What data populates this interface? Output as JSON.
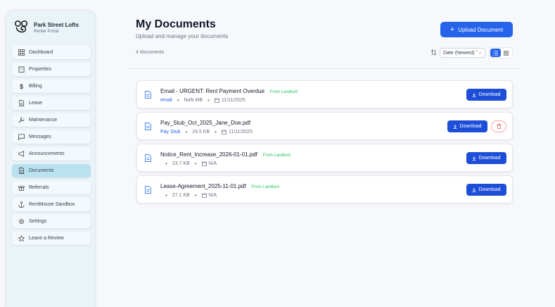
{
  "brand": {
    "name": "Park Street Lofts",
    "subtitle": "Renter Portal"
  },
  "sidebar": {
    "items": [
      {
        "label": "Dashboard",
        "icon": "dashboard-icon",
        "active": false
      },
      {
        "label": "Properties",
        "icon": "building-icon",
        "active": false
      },
      {
        "label": "Billing",
        "icon": "dollar-icon",
        "active": false
      },
      {
        "label": "Lease",
        "icon": "file-icon",
        "active": false
      },
      {
        "label": "Maintenance",
        "icon": "wrench-icon",
        "active": false
      },
      {
        "label": "Messages",
        "icon": "message-icon",
        "active": false
      },
      {
        "label": "Announcements",
        "icon": "megaphone-icon",
        "active": false
      },
      {
        "label": "Documents",
        "icon": "document-icon",
        "active": true
      },
      {
        "label": "Referrals",
        "icon": "gift-icon",
        "active": false
      },
      {
        "label": "RentMouse Sandbox",
        "icon": "anchor-icon",
        "active": false
      },
      {
        "label": "Settings",
        "icon": "gear-icon",
        "active": false
      },
      {
        "label": "Leave a Review",
        "icon": "star-icon",
        "active": false
      }
    ]
  },
  "header": {
    "title": "My Documents",
    "subtitle": "Upload and manage your documents",
    "upload_plus": "+",
    "upload_label": "Upload Document"
  },
  "toolbar": {
    "count": "4 documents",
    "sort_label": "Date (Newest)",
    "sort_chevron": "⌃⌄"
  },
  "colors": {
    "accent": "#2563eb",
    "landlord": "#22c55e",
    "active_nav": "#b9e2ee"
  },
  "documents": [
    {
      "name": "Email - URGENT: Rent Payment Overdue",
      "source": "From Landlord",
      "type": "email",
      "size": "NaN MB",
      "date": "11/11/2025",
      "download_label": "Download",
      "deletable": false
    },
    {
      "name": "Pay_Stub_Oct_2025_Jane_Doe.pdf",
      "source": "",
      "type": "Pay Stub",
      "size": "24.5 KB",
      "date": "11/11/2025",
      "download_label": "Download",
      "deletable": true
    },
    {
      "name": "Notice_Rent_Increase_2026-01-01.pdf",
      "source": "From Landlord",
      "type": "",
      "size": "23.7 KB",
      "date": "N/A",
      "download_label": "Download",
      "deletable": false
    },
    {
      "name": "Lease-Agreement_2025-11-01.pdf",
      "source": "From Landlord",
      "type": "",
      "size": "27.1 KB",
      "date": "N/A",
      "download_label": "Download",
      "deletable": false
    }
  ]
}
